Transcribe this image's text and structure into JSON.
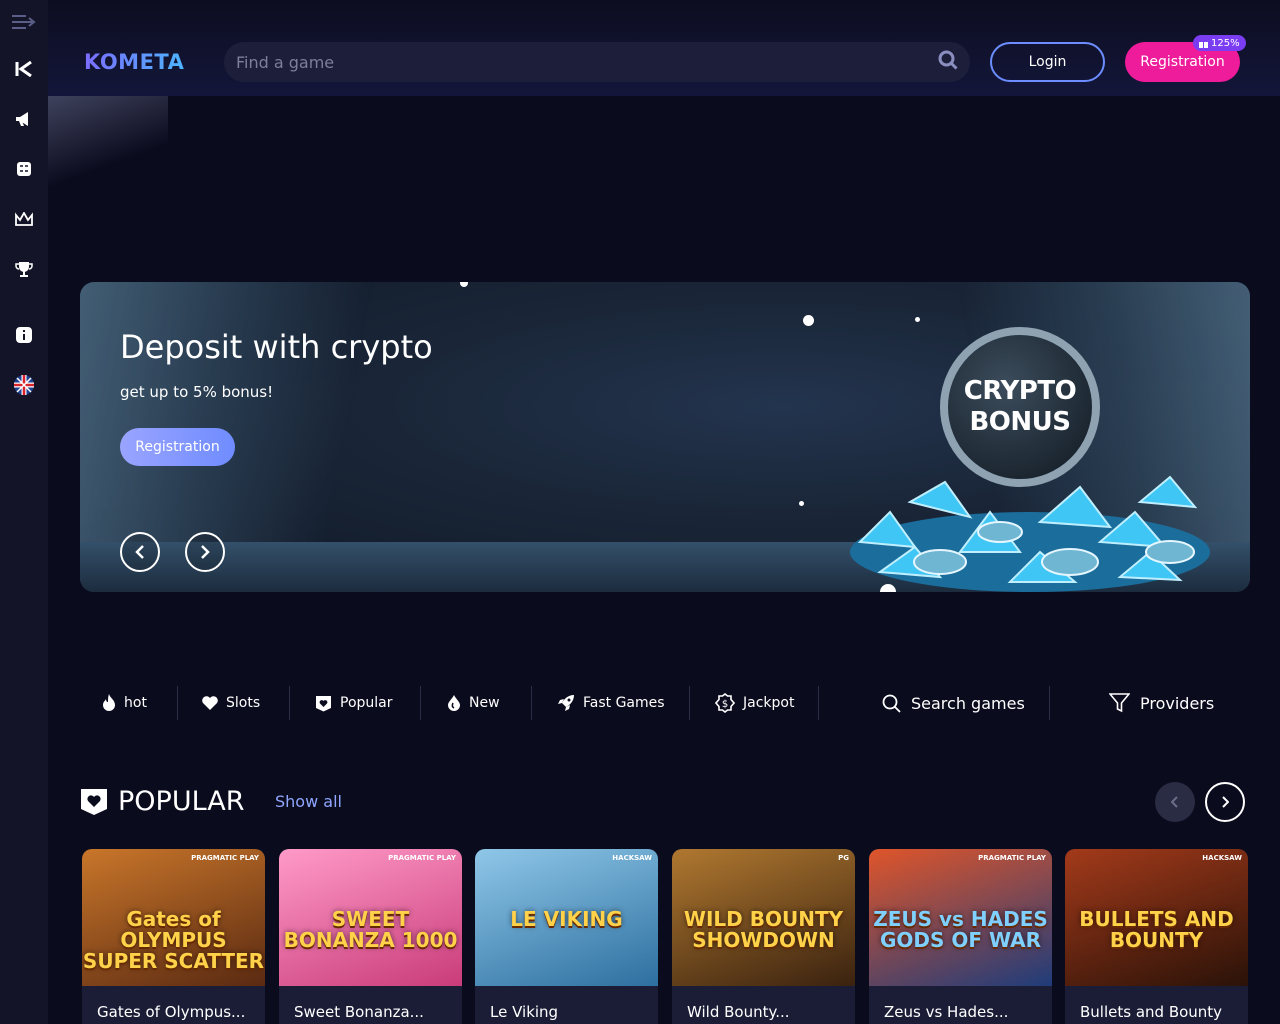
{
  "brand": {
    "logo": "KOMETA"
  },
  "sidebar": {
    "items": [
      {
        "icon": "menu-toggle-icon"
      },
      {
        "icon": "kometa-k-icon"
      },
      {
        "icon": "megaphone-icon"
      },
      {
        "icon": "task-list-icon"
      },
      {
        "icon": "crown-icon"
      },
      {
        "icon": "trophy-icon"
      },
      {
        "icon": "info-icon"
      },
      {
        "icon": "uk-flag-icon"
      }
    ]
  },
  "header": {
    "search_placeholder": "Find a game",
    "login_label": "Login",
    "registration_label": "Registration",
    "registration_badge": "125%"
  },
  "banner": {
    "title": "Deposit with crypto",
    "subtitle": "get up to 5% bonus!",
    "button_label": "Registration",
    "coin_line1": "CRYPTO",
    "coin_line2": "BONUS"
  },
  "filters": [
    {
      "label": "hot",
      "icon": "flame-icon"
    },
    {
      "label": "Slots",
      "icon": "heart-icon"
    },
    {
      "label": "Popular",
      "icon": "heart-badge-icon"
    },
    {
      "label": "New",
      "icon": "drop-icon"
    },
    {
      "label": "Fast Games",
      "icon": "rocket-icon"
    },
    {
      "label": "Jackpot",
      "icon": "dollar-badge-icon"
    },
    {
      "label": "Search games",
      "icon": "search-icon"
    },
    {
      "label": "Providers",
      "icon": "funnel-icon"
    }
  ],
  "popular": {
    "title": "POPULAR",
    "show_all": "Show all",
    "games": [
      {
        "title": "Gates of Olympus...",
        "art": "Gates of OLYMPUS SUPER SCATTER",
        "provider": "PRAGMATIC PLAY",
        "colors": [
          "#5a2a12",
          "#c9762a"
        ]
      },
      {
        "title": "Sweet Bonanza...",
        "art": "SWEET BONANZA 1000",
        "provider": "PRAGMATIC PLAY",
        "colors": [
          "#c93c7a",
          "#ff9ac8"
        ]
      },
      {
        "title": "Le Viking",
        "art": "LE VIKING",
        "provider": "HACKSAW",
        "colors": [
          "#2d6fa0",
          "#8fc7e8"
        ]
      },
      {
        "title": "Wild Bounty...",
        "art": "WILD BOUNTY SHOWDOWN",
        "provider": "PG",
        "colors": [
          "#3a220f",
          "#b07830"
        ]
      },
      {
        "title": "Zeus vs Hades...",
        "art": "ZEUS vs HADES GODS OF WAR",
        "provider": "PRAGMATIC PLAY",
        "colors": [
          "#1f3c7a",
          "#e0552a"
        ]
      },
      {
        "title": "Bullets and Bounty",
        "art": "BULLETS AND BOUNTY",
        "provider": "HACKSAW",
        "colors": [
          "#2a1208",
          "#a33a1a"
        ]
      }
    ]
  }
}
